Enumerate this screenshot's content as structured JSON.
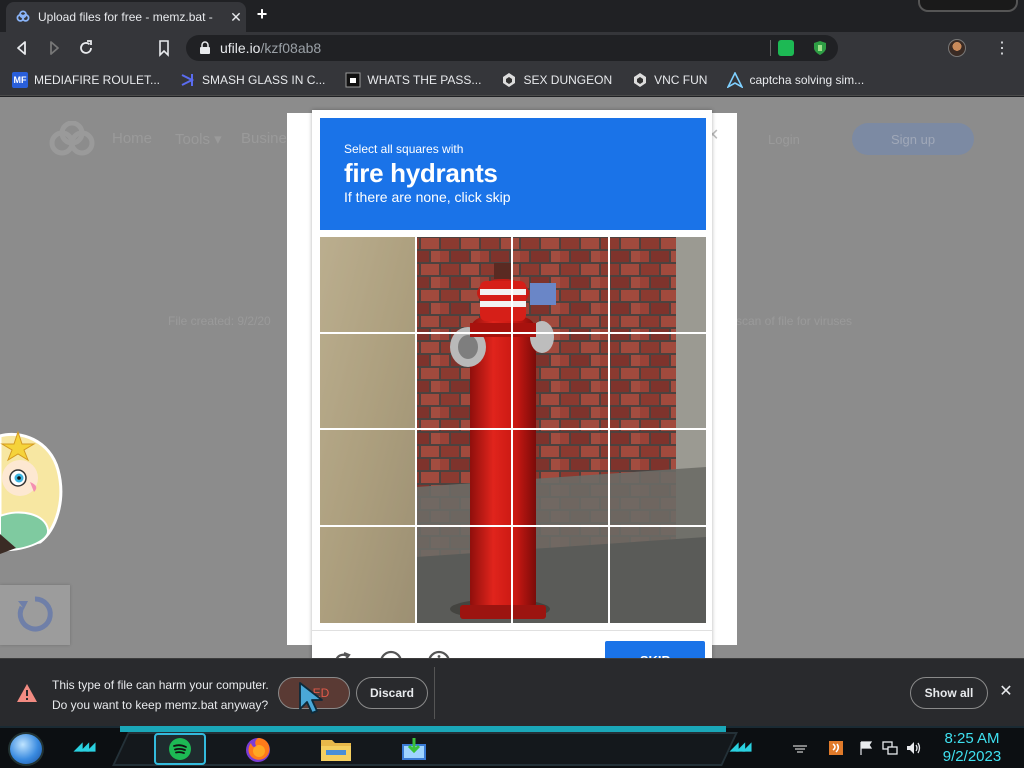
{
  "browser": {
    "tab": {
      "title": "Upload files for free - memz.bat - ",
      "close": "✕"
    },
    "new_tab": "+",
    "address": {
      "host": "ufile.io",
      "path": "/kzf08ab8"
    },
    "menu_icon": "⋮",
    "bookmarks": [
      {
        "label": "MEDIAFIRE ROULET...",
        "icon": "mediafire-icon"
      },
      {
        "label": "SMASH GLASS IN C...",
        "icon": "vs-icon"
      },
      {
        "label": "WHATS THE PASS...",
        "icon": "safe-icon"
      },
      {
        "label": "SEX DUNGEON",
        "icon": "unity-icon"
      },
      {
        "label": "VNC FUN",
        "icon": "unity-icon"
      },
      {
        "label": "captcha solving sim...",
        "icon": "arch-icon"
      }
    ]
  },
  "page": {
    "nav": [
      "Home",
      "Tools ▾",
      "Busine"
    ],
    "login": "Login",
    "signup": "Sign up",
    "file_created": "File created: 9/2/20",
    "scan_text": "scan of file for viruses"
  },
  "captcha": {
    "instruction_top": "Select all squares with",
    "target": "fire hydrants",
    "instruction_sub": "If there are none, click skip",
    "skip_label": "SKIP",
    "tiles": 16
  },
  "download_bar": {
    "warning_line1": "This type of file can harm your computer.",
    "warning_line2": "Do you want to keep memz.bat anyway?",
    "keep_label": "ED",
    "discard_label": "Discard",
    "show_all_label": "Show all",
    "close": "✕"
  },
  "taskbar": {
    "time": "8:25 AM",
    "date": "9/2/2023"
  },
  "colors": {
    "captcha_blue": "#1a73e8",
    "clock_cyan": "#3fe0ef",
    "chrome_dark": "#202124"
  }
}
